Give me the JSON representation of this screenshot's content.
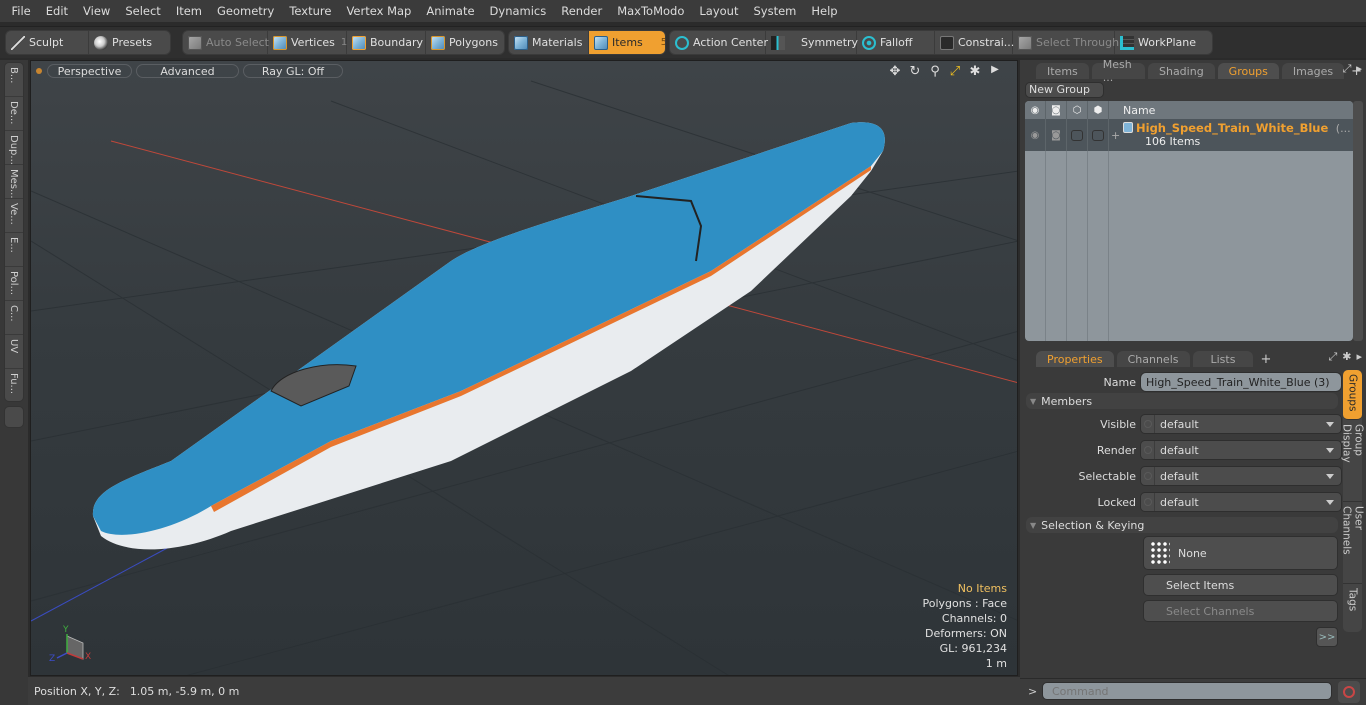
{
  "menubar": [
    "File",
    "Edit",
    "View",
    "Select",
    "Item",
    "Geometry",
    "Texture",
    "Vertex Map",
    "Animate",
    "Dynamics",
    "Render",
    "MaxToModo",
    "Layout",
    "System",
    "Help"
  ],
  "toolbar": {
    "sculpt": "Sculpt",
    "presets": "Presets",
    "auto_select": "Auto Select",
    "vertices": "Vertices",
    "vertices_count": "1",
    "boundary": "Boundary",
    "polygons": "Polygons",
    "materials": "Materials",
    "items": "Items",
    "items_count": "5",
    "action_center": "Action Center",
    "symmetry": "Symmetry",
    "falloff": "Falloff",
    "constraints": "Constrai...",
    "select_through": "Select Through",
    "workplane": "WorkPlane"
  },
  "left_tabs": [
    "B...",
    "De...",
    "Dup...",
    "Mes...",
    "Ve...",
    "E...",
    "Pol...",
    "C...",
    "UV",
    "Fu..."
  ],
  "viewport": {
    "view_mode": "Perspective",
    "shading": "Advanced",
    "raygl": "Ray GL: Off",
    "stats": {
      "selection": "No Items",
      "polygons": "Polygons : Face",
      "channels": "Channels: 0",
      "deformers": "Deformers: ON",
      "gl": "GL: 961,234",
      "scale": "1 m"
    },
    "axis_labels": {
      "x": "X",
      "y": "Y",
      "z": "Z"
    },
    "model_colors": {
      "body_top": "#2f8fc4",
      "stripe": "#e8762e",
      "body_bottom": "#e9ecef"
    }
  },
  "statusbar": {
    "label": "Position X, Y, Z:",
    "value": "1.05 m, -5.9 m, 0 m"
  },
  "top_panel": {
    "tabs": [
      "Items",
      "Mesh ...",
      "Shading",
      "Groups",
      "Images"
    ],
    "active_tab": "Groups",
    "new_group": "New Group",
    "name_header": "Name",
    "group": {
      "name": "High_Speed_Train_White_Blue",
      "suffix": "(...",
      "count": "106 Items"
    }
  },
  "bottom_panel": {
    "tabs": [
      "Properties",
      "Channels",
      "Lists"
    ],
    "active_tab": "Properties",
    "name_label": "Name",
    "name_value": "High_Speed_Train_White_Blue (3)",
    "members_section": "Members",
    "fields": [
      {
        "label": "Visible",
        "value": "default"
      },
      {
        "label": "Render",
        "value": "default"
      },
      {
        "label": "Selectable",
        "value": "default"
      },
      {
        "label": "Locked",
        "value": "default"
      }
    ],
    "selection_section": "Selection & Keying",
    "none_label": "None",
    "select_items": "Select Items",
    "select_channels": "Select Channels",
    "more": ">>",
    "side_tabs": [
      "Groups",
      "Group Display",
      "User Channels",
      "Tags"
    ]
  },
  "command": {
    "prompt": ">",
    "placeholder": "Command"
  },
  "colors": {
    "accent": "#f0a030"
  }
}
